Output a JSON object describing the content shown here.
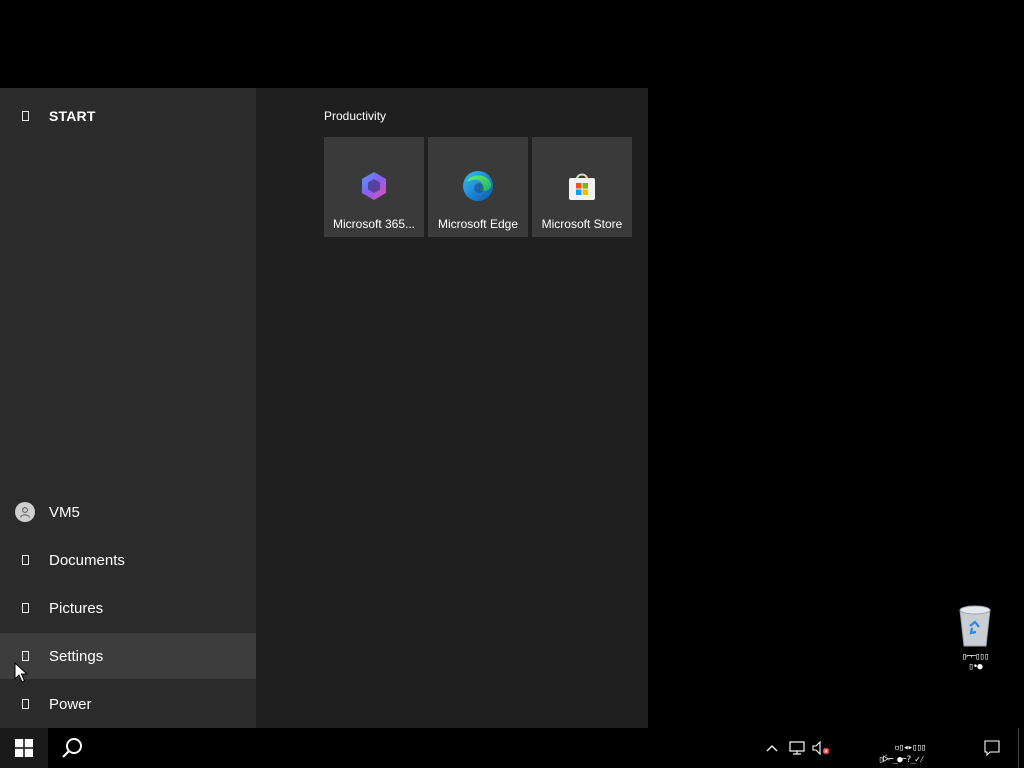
{
  "start_menu": {
    "header_label": "START",
    "user_name": "VM5",
    "nav_items": [
      {
        "label": "Documents",
        "icon": "documents-icon"
      },
      {
        "label": "Pictures",
        "icon": "pictures-icon"
      },
      {
        "label": "Settings",
        "icon": "settings-icon"
      },
      {
        "label": "Power",
        "icon": "power-icon"
      }
    ],
    "group_title": "Productivity",
    "tiles": [
      {
        "label": "Microsoft 365...",
        "icon": "microsoft-365-icon"
      },
      {
        "label": "Microsoft Edge",
        "icon": "edge-icon"
      },
      {
        "label": "Microsoft Store",
        "icon": "store-icon"
      }
    ]
  },
  "desktop": {
    "recycle_bin_label": "▯⌐⌐▯▯▯\n▯•●"
  },
  "taskbar": {
    "clock_text": "▫▯◂▸▯▯▯\n▯ᢰ⌐_●⌐?_✓⁄\n▫▯▯▯▸▯▯_▫▸"
  },
  "colors": {
    "menu_bg": "#1f1f1f",
    "left_pane_bg": "#2b2b2b",
    "tile_bg": "#3a3a3a",
    "hover_bg": "#3d3d3d",
    "taskbar_bg": "#000000"
  }
}
